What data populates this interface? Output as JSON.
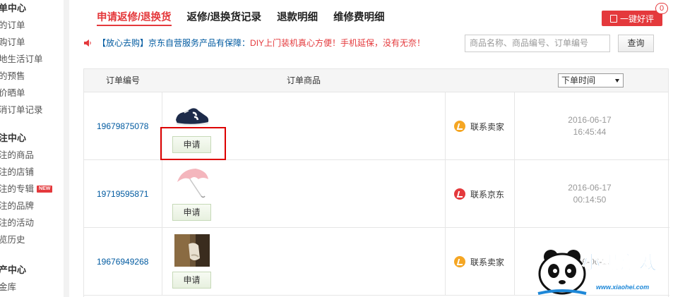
{
  "sidebar": {
    "groups": [
      {
        "title": "单中心",
        "items": [
          "的订单",
          "购订单",
          "地生活订单",
          "的预售",
          "价晒单",
          "消订单记录"
        ]
      },
      {
        "title": "注中心",
        "items": [
          "注的商品",
          "注的店铺",
          "注的专辑",
          "注的品牌",
          "注的活动",
          "览历史"
        ],
        "new_badge": "NEW"
      },
      {
        "title": "产中心",
        "items": [
          "金库"
        ]
      }
    ]
  },
  "tabs": [
    "申请返修/退换货",
    "返修/退换货记录",
    "退款明细",
    "维修费明细"
  ],
  "review_button": {
    "label": "一键好评",
    "badge": "0"
  },
  "notice": {
    "prefix": "【放心去购】",
    "text": "京东自营服务产品有保障：",
    "highlight": "DIY上门装机真心方便！手机延保，没有无奈！"
  },
  "search": {
    "placeholder": "商品名称、商品编号、订单编号",
    "button": "查询"
  },
  "table": {
    "headers": {
      "order_no": "订单编号",
      "product": "订单商品"
    },
    "sort": {
      "selected": "下单时间"
    },
    "rows": [
      {
        "order_no": "19679875078",
        "apply": "申请",
        "contact": "联系卖家",
        "contact_color": "#f5a623",
        "date": "2016-06-17",
        "time": "16:45:44"
      },
      {
        "order_no": "19719595871",
        "apply": "申请",
        "contact": "联系京东",
        "contact_color": "#e4393c",
        "date": "2016-06-17",
        "time": "00:14:50"
      },
      {
        "order_no": "19676949268",
        "apply": "申请",
        "contact": "联系卖家",
        "contact_color": "#f5a623",
        "date": "2016-06-17",
        "time": ""
      }
    ]
  },
  "watermark": {
    "text": "小黑游戏",
    "url": "www.xiaohei.com"
  },
  "colors": {
    "accent": "#e4393c",
    "link": "#005aa0"
  }
}
